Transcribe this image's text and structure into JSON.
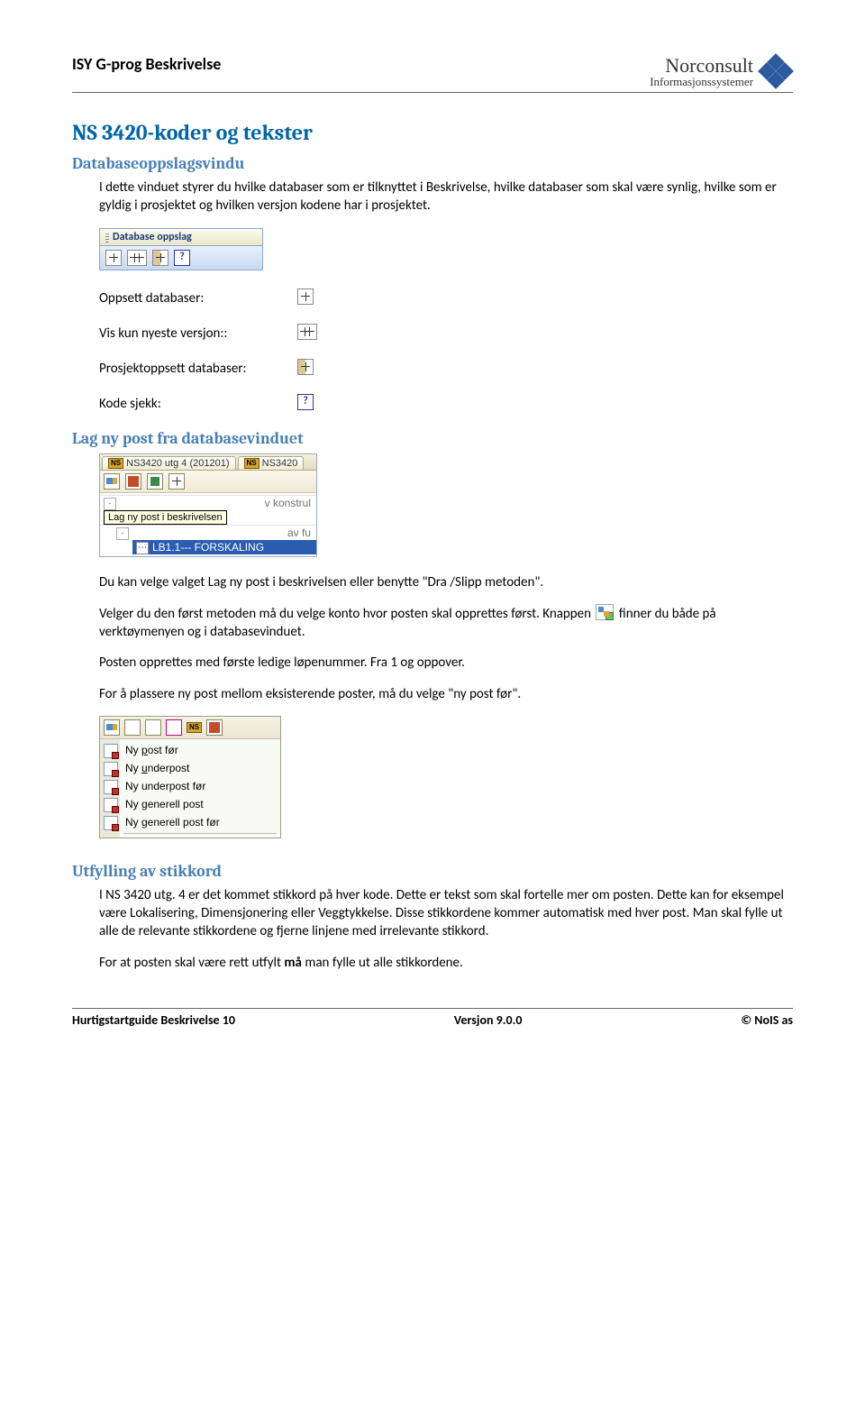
{
  "header": {
    "doc_title": "ISY G-prog Beskrivelse",
    "logo_name": "Norconsult",
    "logo_sub": "Informasjonssystemer"
  },
  "h1": "NS 3420-koder og tekster",
  "sub1": {
    "title": "Databaseoppslagsvindu",
    "para": "I dette vinduet styrer du hvilke databaser som er tilknyttet i Beskrivelse, hvilke databaser som skal være synlig, hvilke som er gyldig i prosjektet og hvilken versjon kodene har i prosjektet."
  },
  "db_panel_title": "Database oppslag",
  "def": {
    "oppsett": "Oppsett databaser:",
    "vis": "Vis kun nyeste versjon::",
    "prosjekt": "Prosjektoppsett databaser:",
    "kode": "Kode sjekk:"
  },
  "sub2": {
    "title": "Lag ny post fra databasevinduet",
    "tab1": "NS3420 utg 4 (201201)",
    "tab2": "NS3420",
    "row_konstru": "v konstrul",
    "tooltip": "Lag ny post i beskrivelsen",
    "row_fur": "av fu",
    "row_sel": "LB1.1--- FORSKALING",
    "para1": "Du kan velge valget Lag ny post i beskrivelsen eller benytte \"Dra /Slipp metoden\".",
    "para2a": "Velger du den først metoden må du velge konto hvor posten skal opprettes først. Knappen ",
    "para2b": " finner du både på verktøymenyen og i databasevinduet.",
    "para3": "Posten opprettes med første ledige løpenummer. Fra 1 og oppover.",
    "para4": "For å plassere ny post mellom eksisterende poster, må du velge \"ny post før\"."
  },
  "menu": {
    "items": [
      {
        "label": "Ny post før",
        "u": "p"
      },
      {
        "label": "Ny underpost",
        "u": "u"
      },
      {
        "label": "Ny underpost før"
      },
      {
        "label": "Ny generell post",
        "u": "g"
      },
      {
        "label": "Ny generell post før"
      }
    ]
  },
  "sub3": {
    "title": "Utfylling av stikkord",
    "para1": "I NS 3420 utg. 4 er det kommet stikkord på hver kode. Dette er tekst som skal fortelle mer om posten. Dette kan for eksempel være Lokalisering, Dimensjonering eller Veggtykkelse. Disse stikkordene kommer automatisk med hver post. Man skal fylle ut alle de relevante stikkordene og fjerne linjene med irrelevante stikkord.",
    "para2a": "For at posten skal være rett utfylt ",
    "para2b": "må",
    "para2c": " man fylle ut alle stikkordene."
  },
  "footer": {
    "left": "Hurtigstartguide Beskrivelse 10",
    "center": "Versjon 9.0.0",
    "right": "© NoIS as"
  }
}
